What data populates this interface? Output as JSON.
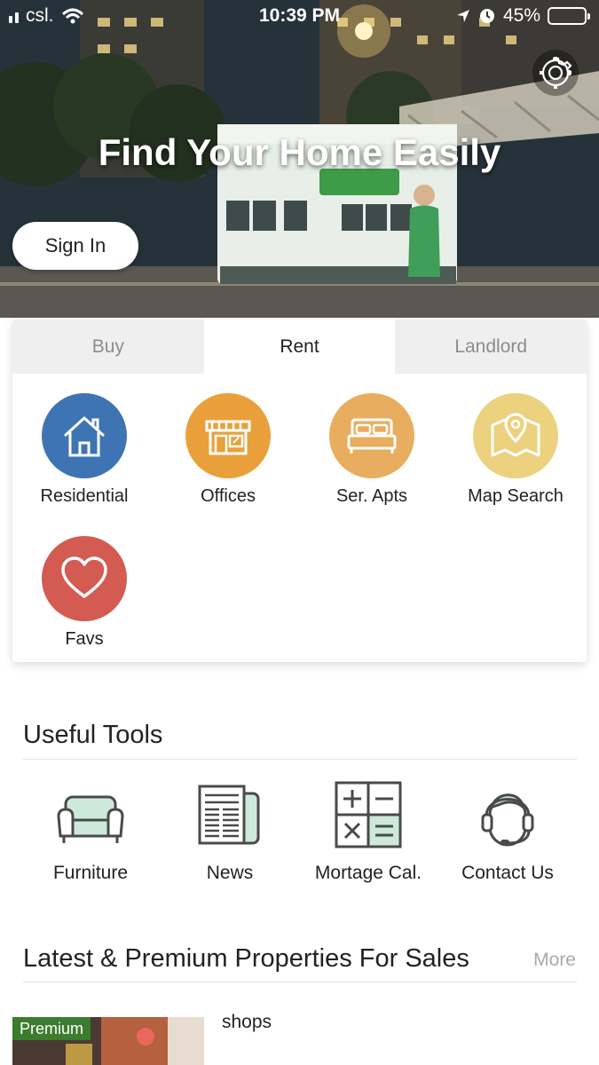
{
  "status_bar": {
    "carrier": "csl.",
    "time": "10:39 PM",
    "battery_percent": "45%",
    "battery_level": 0.45,
    "battery_color": "#f6c948"
  },
  "hero": {
    "title": "Find Your Home Easily",
    "signin_label": "Sign In",
    "settings_icon": "gear-icon"
  },
  "tabs": [
    {
      "label": "Buy",
      "active": false
    },
    {
      "label": "Rent",
      "active": true
    },
    {
      "label": "Landlord",
      "active": false
    }
  ],
  "categories": [
    {
      "label": "Residential",
      "icon": "house-icon",
      "color": "#3f74b4"
    },
    {
      "label": "Offices",
      "icon": "storefront-icon",
      "color": "#e9a03a"
    },
    {
      "label": "Ser. Apts",
      "icon": "bed-icon",
      "color": "#e8ad5e"
    },
    {
      "label": "Map Search",
      "icon": "map-pin-icon",
      "color": "#ecd27e"
    },
    {
      "label": "Favs",
      "icon": "heart-icon",
      "color": "#d35b52"
    }
  ],
  "tools": {
    "title": "Useful Tools",
    "items": [
      {
        "label": "Furniture",
        "icon": "sofa-icon"
      },
      {
        "label": "News",
        "icon": "newspaper-icon"
      },
      {
        "label": "Mortage Cal.",
        "icon": "calculator-icon"
      },
      {
        "label": "Contact Us",
        "icon": "headset-icon"
      }
    ]
  },
  "properties": {
    "title": "Latest & Premium Properties For Sales",
    "more_label": "More",
    "items": [
      {
        "badge": "Premium",
        "type": "shops",
        "badge_color": "#3c7c2e"
      }
    ]
  }
}
